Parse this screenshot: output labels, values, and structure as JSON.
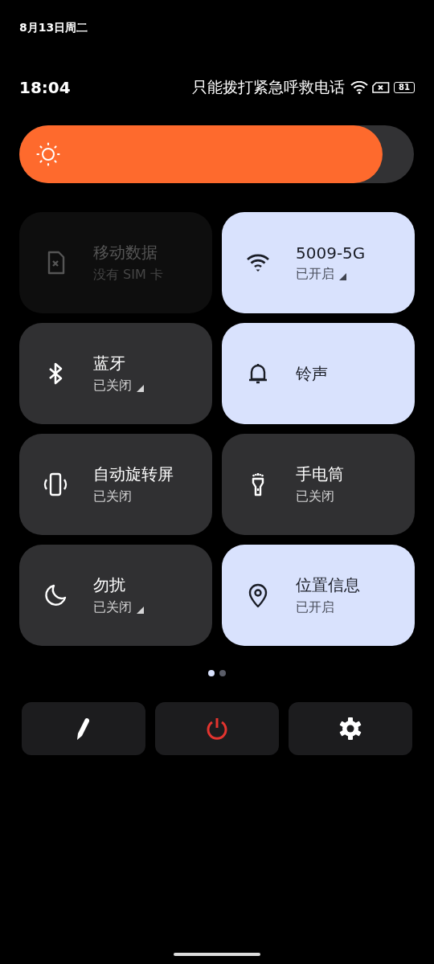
{
  "header": {
    "date": "8月13日周二",
    "time": "18:04",
    "carrier": "只能拨打紧急呼救电话",
    "battery": "81"
  },
  "brightness": {
    "level": 0.92
  },
  "tiles": [
    {
      "title": "移动数据",
      "subtitle": "没有 SIM 卡",
      "on": false,
      "disabled": true,
      "has_menu": false
    },
    {
      "title": "5009-5G",
      "subtitle": "已开启",
      "on": true,
      "disabled": false,
      "has_menu": true
    },
    {
      "title": "蓝牙",
      "subtitle": "已关闭",
      "on": false,
      "disabled": false,
      "has_menu": true
    },
    {
      "title": "铃声",
      "on": true,
      "disabled": false,
      "has_menu": false
    },
    {
      "title": "自动旋转屏",
      "subtitle": "已关闭",
      "on": false,
      "disabled": false,
      "has_menu": false
    },
    {
      "title": "手电筒",
      "subtitle": "已关闭",
      "on": false,
      "disabled": false,
      "has_menu": false
    },
    {
      "title": "勿扰",
      "subtitle": "已关闭",
      "on": false,
      "disabled": false,
      "has_menu": true
    },
    {
      "title": "位置信息",
      "subtitle": "已开启",
      "on": true,
      "disabled": false,
      "has_menu": false
    }
  ],
  "pages": [
    {
      "selected": true
    },
    {
      "selected": false
    }
  ]
}
